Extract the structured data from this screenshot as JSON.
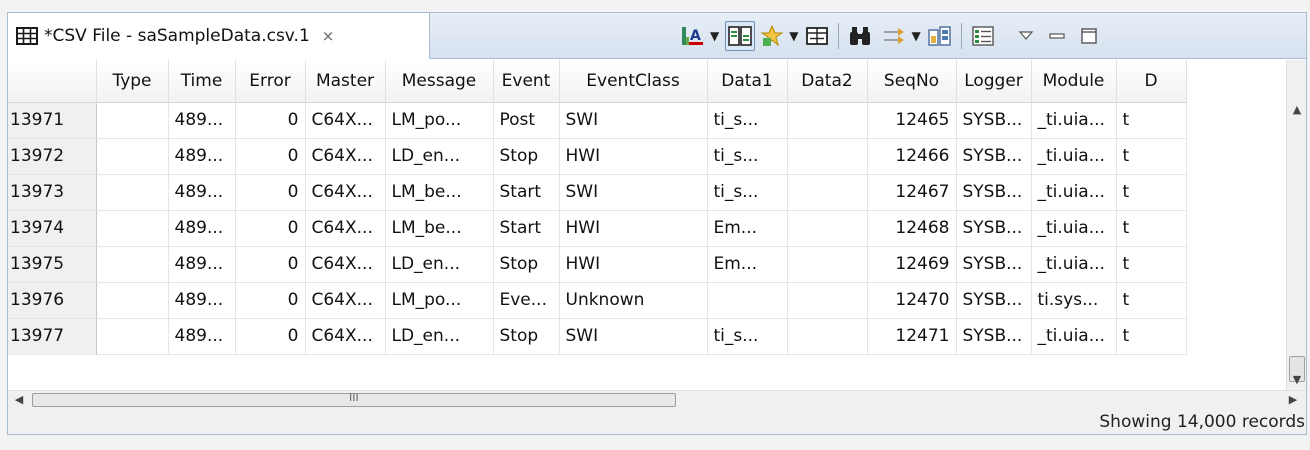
{
  "tab": {
    "icon": "table-grid-icon",
    "title": "*CSV File - saSampleData.csv.1",
    "close_icon": "close-tab-icon"
  },
  "toolbar": {
    "icons": [
      "font-color-icon",
      "column-toggle-icon",
      "wizard-icon",
      "fit-columns-icon",
      "binoculars-find-icon",
      "filter-icon",
      "group-icon",
      "columns-settings-icon",
      "view-menu-icon",
      "minimize-icon",
      "maximize-icon"
    ]
  },
  "columns": [
    "",
    "Type",
    "Time",
    "Error",
    "Master",
    "Message",
    "Event",
    "EventClass",
    "Data1",
    "Data2",
    "SeqNo",
    "Logger",
    "Module",
    "D"
  ],
  "rows": [
    [
      "13971",
      "",
      "489...",
      "0",
      "C64X...",
      "LM_po...",
      "Post",
      "SWI",
      "ti_s...",
      "",
      "12465",
      "SYSB...",
      "_ti.uia...",
      "t"
    ],
    [
      "13972",
      "",
      "489...",
      "0",
      "C64X...",
      "LD_en...",
      "Stop",
      "HWI",
      "ti_s...",
      "",
      "12466",
      "SYSB...",
      "_ti.uia...",
      "t"
    ],
    [
      "13973",
      "",
      "489...",
      "0",
      "C64X...",
      "LM_be...",
      "Start",
      "SWI",
      "ti_s...",
      "",
      "12467",
      "SYSB...",
      "_ti.uia...",
      "t"
    ],
    [
      "13974",
      "",
      "489...",
      "0",
      "C64X...",
      "LM_be...",
      "Start",
      "HWI",
      "Em...",
      "",
      "12468",
      "SYSB...",
      "_ti.uia...",
      "t"
    ],
    [
      "13975",
      "",
      "489...",
      "0",
      "C64X...",
      "LD_en...",
      "Stop",
      "HWI",
      "Em...",
      "",
      "12469",
      "SYSB...",
      "_ti.uia...",
      "t"
    ],
    [
      "13976",
      "",
      "489...",
      "0",
      "C64X...",
      "LM_po...",
      "Eve...",
      "Unknown",
      "",
      "",
      "12470",
      "SYSB...",
      "ti.sys...",
      "t"
    ],
    [
      "13977",
      "",
      "489...",
      "0",
      "C64X...",
      "LD_en...",
      "Stop",
      "SWI",
      "ti_s...",
      "",
      "12471",
      "SYSB...",
      "_ti.uia...",
      "t"
    ]
  ],
  "hscroll_grip": "III",
  "status": {
    "text": "Showing 14,000 records"
  }
}
